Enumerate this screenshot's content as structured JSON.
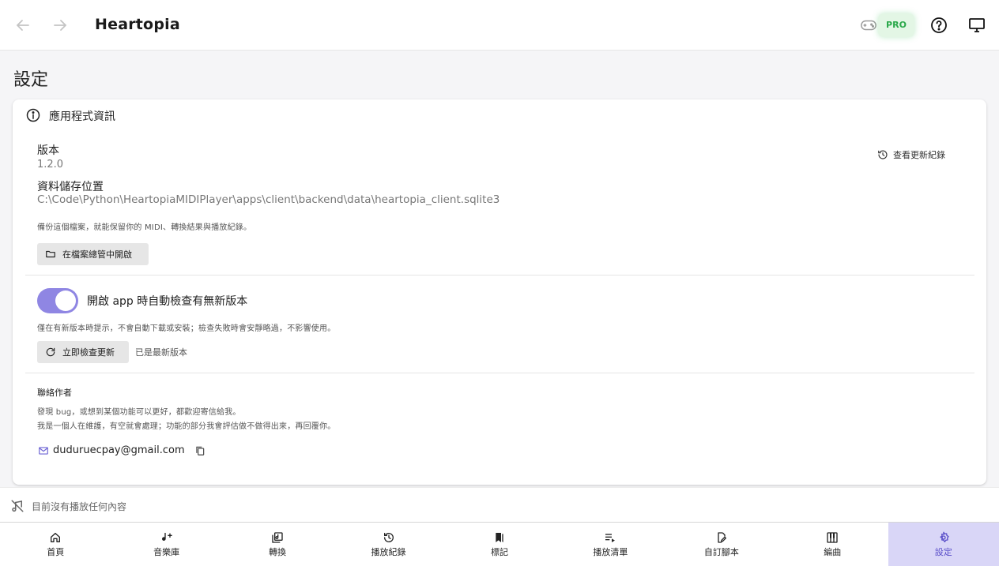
{
  "header": {
    "title": "Heartopia",
    "pro_badge": "PRO",
    "icons": [
      "back-arrow-icon",
      "forward-arrow-icon",
      "gamepad-icon",
      "help-icon",
      "monitor-icon"
    ]
  },
  "page": {
    "title": "設定"
  },
  "app_info": {
    "heading": "應用程式資訊",
    "version_label": "版本",
    "version_value": "1.2.0",
    "update_log_label": "查看更新紀錄",
    "storage_label": "資料儲存位置",
    "storage_path": "C:\\Code\\Python\\HeartopiaMIDIPlayer\\apps\\client\\backend\\data\\heartopia_client.sqlite3",
    "backup_note": "備份這個檔案，就能保留你的 MIDI、轉換結果與播放紀錄。",
    "open_folder_label": "在檔案總管中開啟"
  },
  "auto_update": {
    "enabled": true,
    "label": "開啟 app 時自動檢查有無新版本",
    "note": "僅在有新版本時提示，不會自動下載或安裝；檢查失敗時會安靜略過，不影響使用。",
    "check_now_label": "立即檢查更新",
    "status": "已是最新版本"
  },
  "contact": {
    "title": "聯絡作者",
    "line1": "發現 bug，或想到某個功能可以更好，都歡迎寄信給我。",
    "line2": "我是一個人在維護，有空就會處理；功能的部分我會評估做不做得出來，再回覆你。",
    "email": "duduruecpay@gmail.com"
  },
  "now_playing": {
    "text": "目前沒有播放任何內容"
  },
  "bottom_nav": [
    {
      "label": "首頁",
      "icon": "home-icon"
    },
    {
      "label": "音樂庫",
      "icon": "music-library-icon"
    },
    {
      "label": "轉換",
      "icon": "convert-icon"
    },
    {
      "label": "播放紀錄",
      "icon": "history-icon"
    },
    {
      "label": "標記",
      "icon": "bookmark-icon"
    },
    {
      "label": "播放清單",
      "icon": "playlist-icon"
    },
    {
      "label": "自訂腳本",
      "icon": "script-icon"
    },
    {
      "label": "編曲",
      "icon": "piano-icon"
    },
    {
      "label": "設定",
      "icon": "settings-icon",
      "active": true
    }
  ],
  "colors": {
    "accent": "#8f86e3",
    "active_nav_bg": "#d9d6f7",
    "active_nav_fg": "#5a4fc9",
    "pro_green": "#2aa84a"
  }
}
